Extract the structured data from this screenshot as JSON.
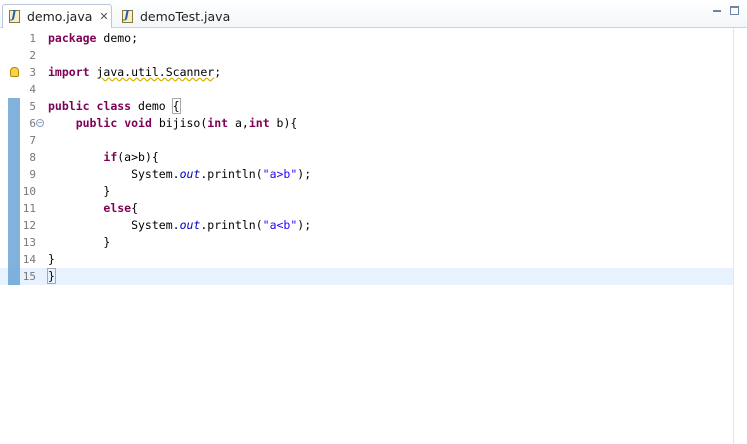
{
  "tabs": [
    {
      "label": "demo.java",
      "active": true,
      "close": "✕"
    },
    {
      "label": "demoTest.java",
      "active": false
    }
  ],
  "editor": {
    "current_line": 15,
    "lines": [
      {
        "n": "1",
        "tokens": [
          {
            "t": "package",
            "c": "kw"
          },
          {
            "t": " demo;"
          }
        ]
      },
      {
        "n": "2",
        "tokens": []
      },
      {
        "n": "3",
        "warning": true,
        "tokens": [
          {
            "t": "import",
            "c": "kw"
          },
          {
            "t": " "
          },
          {
            "t": "java.util.Scanner",
            "c": "squig"
          },
          {
            "t": ";"
          }
        ]
      },
      {
        "n": "4",
        "tokens": []
      },
      {
        "n": "5",
        "marked": true,
        "tokens": [
          {
            "t": "public",
            "c": "kw"
          },
          {
            "t": " "
          },
          {
            "t": "class",
            "c": "kw"
          },
          {
            "t": " demo "
          },
          {
            "t": "{",
            "c": "brace-box"
          }
        ]
      },
      {
        "n": "6",
        "marked": true,
        "fold": true,
        "tokens": [
          {
            "t": "    "
          },
          {
            "t": "public",
            "c": "kw"
          },
          {
            "t": " "
          },
          {
            "t": "void",
            "c": "kw"
          },
          {
            "t": " bijiso("
          },
          {
            "t": "int",
            "c": "kw"
          },
          {
            "t": " a,"
          },
          {
            "t": "int",
            "c": "kw"
          },
          {
            "t": " b){"
          }
        ]
      },
      {
        "n": "7",
        "marked": true,
        "tokens": []
      },
      {
        "n": "8",
        "marked": true,
        "tokens": [
          {
            "t": "        "
          },
          {
            "t": "if",
            "c": "kw"
          },
          {
            "t": "(a>b){"
          }
        ]
      },
      {
        "n": "9",
        "marked": true,
        "tokens": [
          {
            "t": "            System."
          },
          {
            "t": "out",
            "c": "fld"
          },
          {
            "t": ".println("
          },
          {
            "t": "\"a>b\"",
            "c": "str"
          },
          {
            "t": ");"
          }
        ]
      },
      {
        "n": "10",
        "marked": true,
        "tokens": [
          {
            "t": "        }"
          }
        ]
      },
      {
        "n": "11",
        "marked": true,
        "tokens": [
          {
            "t": "        "
          },
          {
            "t": "else",
            "c": "kw"
          },
          {
            "t": "{"
          }
        ]
      },
      {
        "n": "12",
        "marked": true,
        "tokens": [
          {
            "t": "            System."
          },
          {
            "t": "out",
            "c": "fld"
          },
          {
            "t": ".println("
          },
          {
            "t": "\"a<b\"",
            "c": "str"
          },
          {
            "t": ");"
          }
        ]
      },
      {
        "n": "13",
        "marked": true,
        "tokens": [
          {
            "t": "        }"
          }
        ]
      },
      {
        "n": "14",
        "marked": true,
        "tokens": [
          {
            "t": "}"
          }
        ]
      },
      {
        "n": "15",
        "marked": true,
        "tokens": [
          {
            "t": "}",
            "c": "brace-box"
          }
        ]
      }
    ]
  }
}
